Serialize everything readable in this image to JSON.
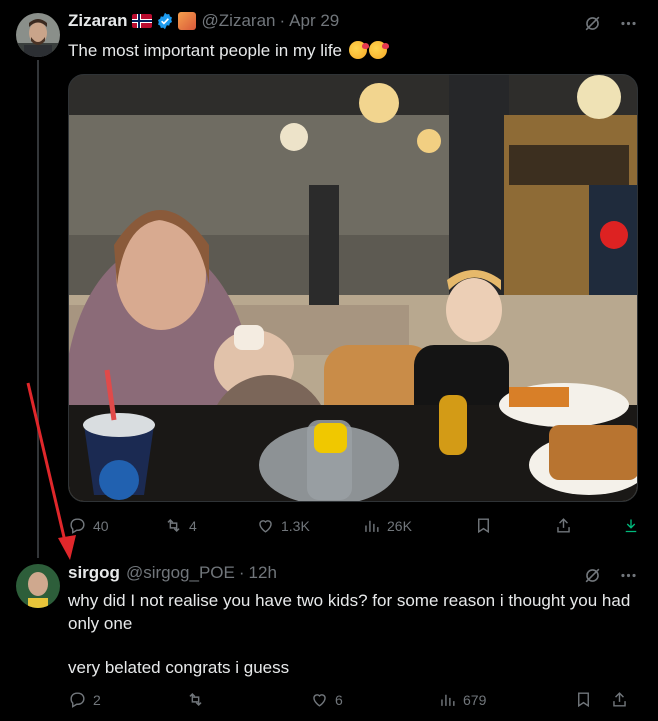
{
  "colors": {
    "background": "#000000",
    "text": "#e7e9ea",
    "muted": "#71767b",
    "verified": "#1d9bf0",
    "arrow": "#e0272b",
    "download": "#00ba7c"
  },
  "tweet": {
    "author_name": "Zizaran",
    "handle": "@Zizaran",
    "separator": "·",
    "date": "Apr 29",
    "text": "The most important people in my life",
    "icons": [
      "norway-flag-icon",
      "verified-icon",
      "badge-icon",
      "grok-icon",
      "more-icon"
    ],
    "actions": {
      "replies": "40",
      "reposts": "4",
      "likes": "1.3K",
      "views": "26K"
    }
  },
  "reply": {
    "author_name": "sirgog",
    "handle": "@sirgog_POE",
    "separator": "·",
    "time": "12h",
    "text_line1": "why did I not realise you have two kids? for some reason i thought you had only one",
    "text_line2": "very belated congrats i guess",
    "actions": {
      "replies": "2",
      "reposts": "",
      "likes": "6",
      "views": "679"
    }
  }
}
